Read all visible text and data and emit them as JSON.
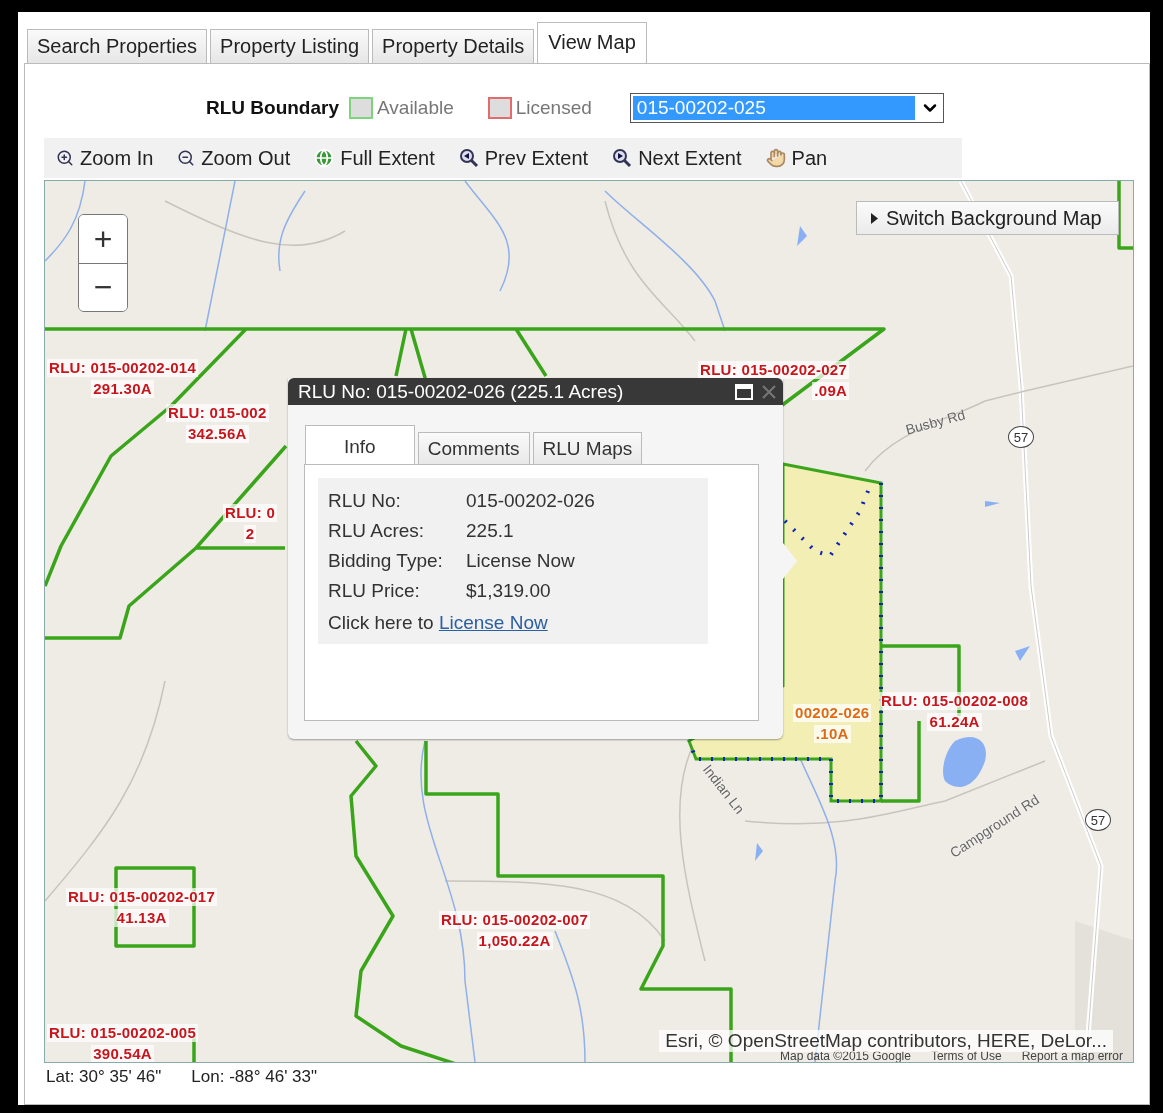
{
  "tabs": [
    {
      "label": "Search Properties",
      "selected": false
    },
    {
      "label": "Property Listing",
      "selected": false
    },
    {
      "label": "Property Details",
      "selected": false
    },
    {
      "label": "View Map",
      "selected": true
    }
  ],
  "legend": {
    "title": "RLU Boundary",
    "items": [
      {
        "label": "Available",
        "color": "#7ed37e"
      },
      {
        "label": "Licensed",
        "color": "#e26b6b"
      }
    ]
  },
  "rlu_select": {
    "value": "015-00202-025"
  },
  "toolbar": [
    {
      "label": "Zoom In",
      "kind": "zoom-in"
    },
    {
      "label": "Zoom Out",
      "kind": "zoom-out"
    },
    {
      "label": "Full Extent",
      "kind": "globe"
    },
    {
      "label": "Prev Extent",
      "kind": "prev"
    },
    {
      "label": "Next Extent",
      "kind": "next"
    },
    {
      "label": "Pan",
      "kind": "hand"
    }
  ],
  "map": {
    "zoom_controls": [
      "+",
      "−"
    ],
    "switch_button": "Switch Background Map",
    "parcel_labels": [
      {
        "lines": [
          "RLU: 015-00202-014",
          "291.30A"
        ],
        "selected": false
      },
      {
        "lines": [
          "RLU: 015-002",
          "342.56A"
        ],
        "selected": false
      },
      {
        "lines": [
          "RLU: 0",
          "2"
        ],
        "selected": false
      },
      {
        "lines": [
          "RLU: 015-00202-027",
          ".09A"
        ],
        "selected": false
      },
      {
        "lines": [
          "00202-026",
          ".10A"
        ],
        "selected": true
      },
      {
        "lines": [
          "RLU: 015-00202-008",
          "61.24A"
        ],
        "selected": false
      },
      {
        "lines": [
          "RLU: 015-00202-017",
          "41.13A"
        ],
        "selected": false
      },
      {
        "lines": [
          "RLU: 015-00202-007",
          "1,050.22A"
        ],
        "selected": false
      },
      {
        "lines": [
          "RLU: 015-00202-005",
          "390.54A"
        ],
        "selected": false
      }
    ],
    "road_labels": [
      {
        "text": "Busby Rd",
        "kind": "road"
      },
      {
        "text": "57",
        "kind": "shield"
      },
      {
        "text": "57",
        "kind": "shield"
      },
      {
        "text": "Indian Ln",
        "kind": "road"
      },
      {
        "text": "Campground Rd",
        "kind": "road"
      }
    ],
    "attribution": "Esri, © OpenStreetMap contributors, HERE, DeLor...",
    "base_credits": [
      "Map data ©2015 Google",
      "Terms of Use",
      "Report a map error"
    ],
    "popup": {
      "title": "RLU No: 015-00202-026 (225.1 Acres)",
      "tabs": [
        {
          "label": "Info",
          "selected": true
        },
        {
          "label": "Comments",
          "selected": false
        },
        {
          "label": "RLU Maps",
          "selected": false
        }
      ],
      "fields": [
        {
          "label": "RLU No:",
          "value": "015-00202-026"
        },
        {
          "label": "RLU Acres:",
          "value": "225.1"
        },
        {
          "label": "Bidding Type:",
          "value": "License Now"
        },
        {
          "label": "RLU Price:",
          "value": "$1,319.00"
        }
      ],
      "action": {
        "text": "Click here to",
        "link": "License Now"
      }
    }
  },
  "status_bar": {
    "lat": "Lat: 30° 35' 46\"",
    "lon": "Lon: -88° 46' 33\""
  }
}
